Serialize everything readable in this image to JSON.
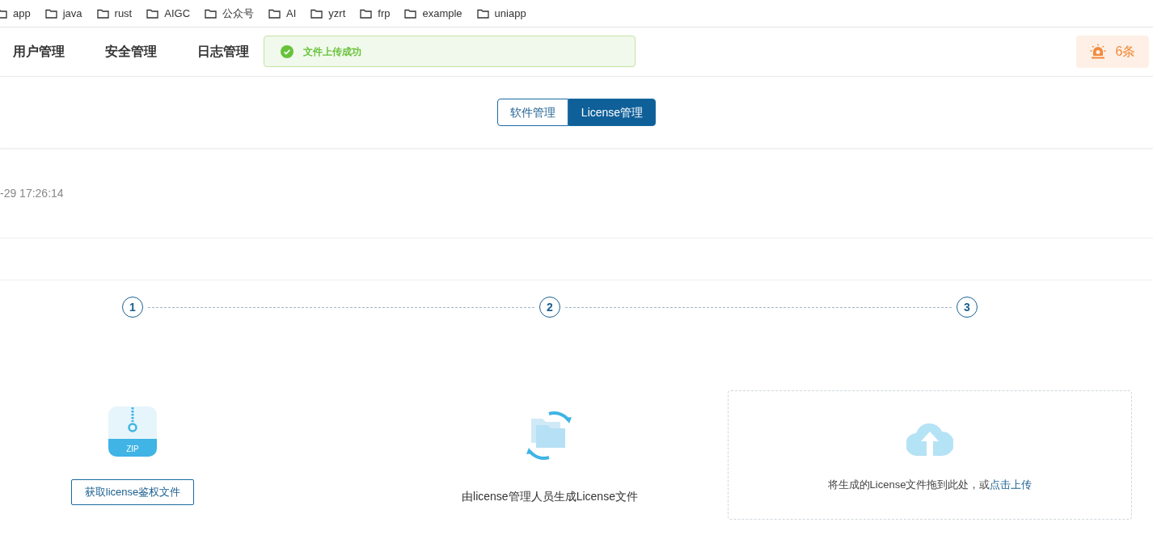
{
  "bookmarks": [
    "app",
    "java",
    "rust",
    "AIGC",
    "公众号",
    "AI",
    "yzrt",
    "frp",
    "example",
    "uniapp"
  ],
  "nav": {
    "items": [
      "用户管理",
      "安全管理",
      "日志管理"
    ]
  },
  "toast": {
    "kind": "success",
    "message": "文件上传成功"
  },
  "alarm": {
    "count": "6条"
  },
  "tabs": [
    {
      "label": "软件管理",
      "selected": false
    },
    {
      "label": "License管理",
      "selected": true
    }
  ],
  "record": {
    "time": "-29 17:26:14"
  },
  "steps": [
    "1",
    "2",
    "3"
  ],
  "panels": [
    {
      "kind": "download",
      "icon_label": "ZIP",
      "button": "获取license鉴权文件"
    },
    {
      "kind": "generate",
      "text": "由license管理人员生成License文件"
    },
    {
      "kind": "upload",
      "text": "将生成的License文件拖到此处，或",
      "link": "点击上传"
    }
  ]
}
